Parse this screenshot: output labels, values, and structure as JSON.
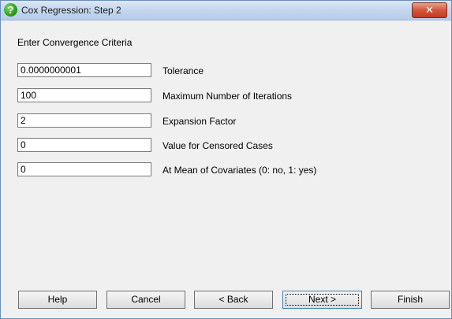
{
  "window": {
    "title": "Cox Regression: Step 2",
    "close_glyph": "✕",
    "icon_glyph": "?"
  },
  "section": {
    "title": "Enter Convergence Criteria"
  },
  "fields": [
    {
      "value": "0.0000000001",
      "label": "Tolerance"
    },
    {
      "value": "100",
      "label": "Maximum Number of Iterations"
    },
    {
      "value": "2",
      "label": "Expansion Factor"
    },
    {
      "value": "0",
      "label": "Value for Censored Cases"
    },
    {
      "value": "0",
      "label": "At Mean of Covariates (0: no, 1: yes)"
    }
  ],
  "buttons": {
    "help": "Help",
    "cancel": "Cancel",
    "back": "< Back",
    "next": "Next >",
    "finish": "Finish"
  }
}
